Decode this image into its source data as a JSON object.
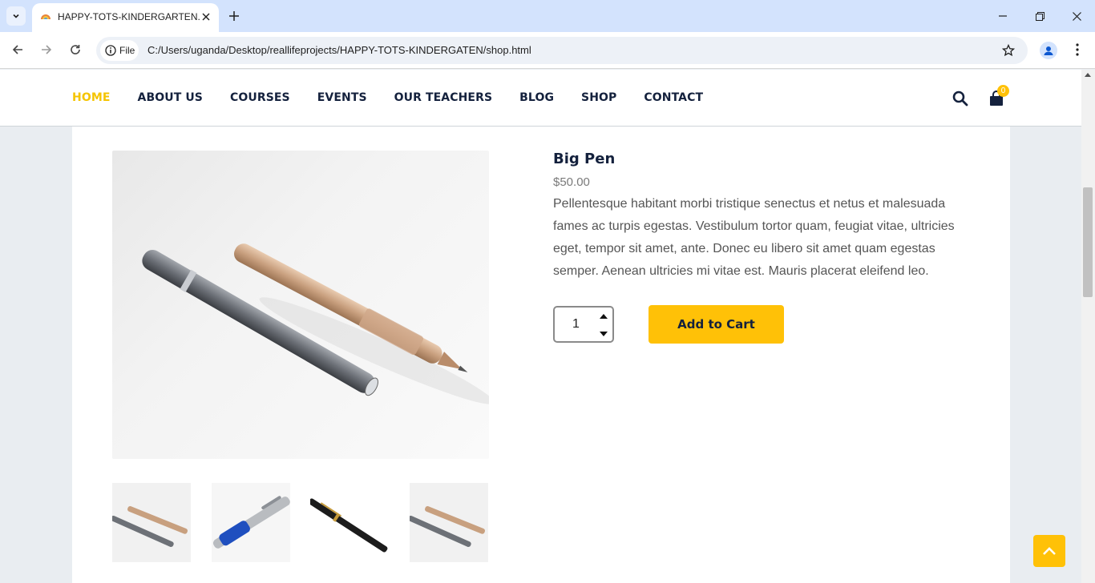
{
  "browser": {
    "tab_title": "HAPPY-TOTS-KINDERGARTEN.",
    "site_chip_label": "File",
    "url": "C:/Users/uganda/Desktop/reallifeprojects/HAPPY-TOTS-KINDERGATEN/shop.html"
  },
  "nav": {
    "items": [
      {
        "label": "HOME",
        "active": true
      },
      {
        "label": "ABOUT US"
      },
      {
        "label": "COURSES"
      },
      {
        "label": "EVENTS"
      },
      {
        "label": "OUR TEACHERS"
      },
      {
        "label": "BLOG"
      },
      {
        "label": "SHOP"
      },
      {
        "label": "CONTACT"
      }
    ],
    "cart_count": "0"
  },
  "product": {
    "title": "Big Pen",
    "price": "$50.00",
    "description": "Pellentesque habitant morbi tristique senectus et netus et malesuada fames ac turpis egestas. Vestibulum tortor quam, feugiat vitae, ultricies eget, tempor sit amet, ante. Donec eu libero sit amet quam egestas semper. Aenean ultricies mi vitae est. Mauris placerat eleifend leo.",
    "quantity": "1",
    "add_to_cart_label": "Add to Cart"
  },
  "colors": {
    "accent": "#ffc107",
    "nav_text": "#14213d",
    "active_nav": "#f5c400"
  }
}
